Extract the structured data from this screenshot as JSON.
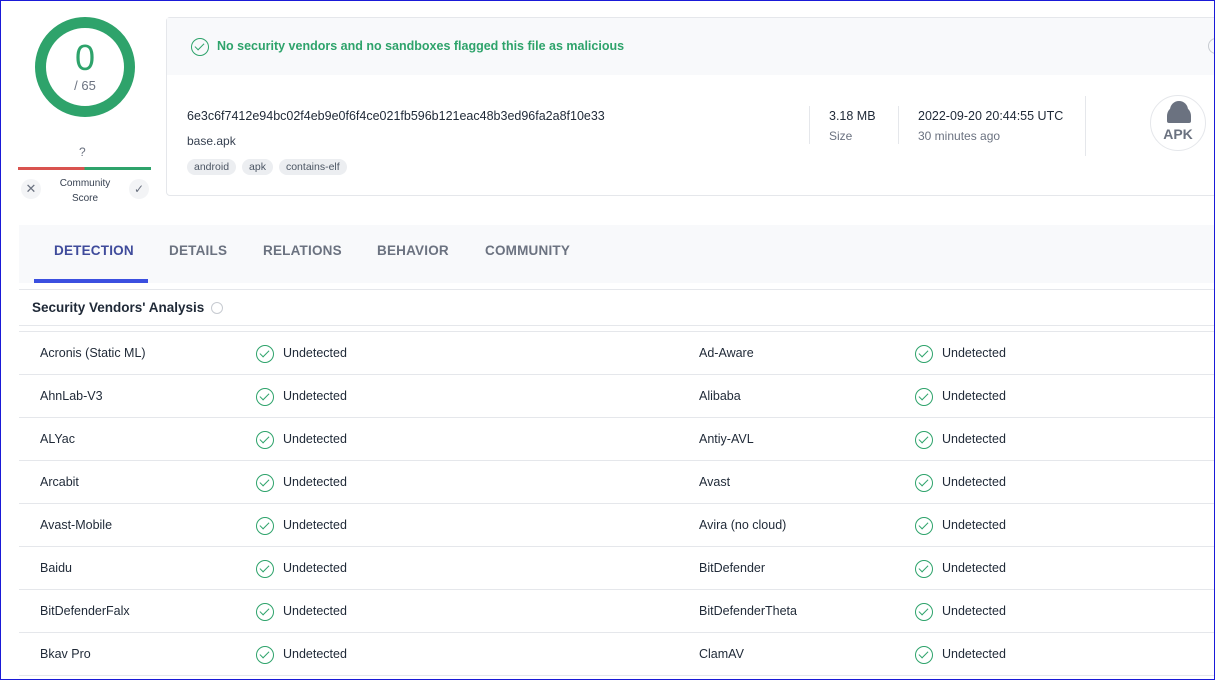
{
  "score": {
    "detections": "0",
    "total": "/ 65"
  },
  "community": {
    "question_mark": "?",
    "label": "Community Score",
    "dislike_icon": "close-icon",
    "like_icon": "check-icon"
  },
  "banner": {
    "message": "No security vendors and no sandboxes flagged this file as malicious",
    "color": "#2ea36b"
  },
  "file": {
    "sha256": "6e3c6f7412e94bc02f4eb9e0f6f4ce021fb596b121eac48b3ed96fa2a8f10e33",
    "name": "base.apk",
    "tags": [
      "android",
      "apk",
      "contains-elf"
    ],
    "size": "3.18 MB",
    "size_label": "Size",
    "date": "2022-09-20 20:44:55 UTC",
    "date_ago": "30 minutes ago",
    "type_icon_label": "APK"
  },
  "tabs": [
    {
      "label": "DETECTION",
      "active": true
    },
    {
      "label": "DETAILS",
      "active": false
    },
    {
      "label": "RELATIONS",
      "active": false
    },
    {
      "label": "BEHAVIOR",
      "active": false
    },
    {
      "label": "COMMUNITY",
      "active": false
    }
  ],
  "analysis": {
    "title": "Security Vendors' Analysis",
    "rows": [
      {
        "left_vendor": "Acronis (Static ML)",
        "left_result": "Undetected",
        "right_vendor": "Ad-Aware",
        "right_result": "Undetected"
      },
      {
        "left_vendor": "AhnLab-V3",
        "left_result": "Undetected",
        "right_vendor": "Alibaba",
        "right_result": "Undetected"
      },
      {
        "left_vendor": "ALYac",
        "left_result": "Undetected",
        "right_vendor": "Antiy-AVL",
        "right_result": "Undetected"
      },
      {
        "left_vendor": "Arcabit",
        "left_result": "Undetected",
        "right_vendor": "Avast",
        "right_result": "Undetected"
      },
      {
        "left_vendor": "Avast-Mobile",
        "left_result": "Undetected",
        "right_vendor": "Avira (no cloud)",
        "right_result": "Undetected"
      },
      {
        "left_vendor": "Baidu",
        "left_result": "Undetected",
        "right_vendor": "BitDefender",
        "right_result": "Undetected"
      },
      {
        "left_vendor": "BitDefenderFalx",
        "left_result": "Undetected",
        "right_vendor": "BitDefenderTheta",
        "right_result": "Undetected"
      },
      {
        "left_vendor": "Bkav Pro",
        "left_result": "Undetected",
        "right_vendor": "ClamAV",
        "right_result": "Undetected"
      }
    ]
  }
}
